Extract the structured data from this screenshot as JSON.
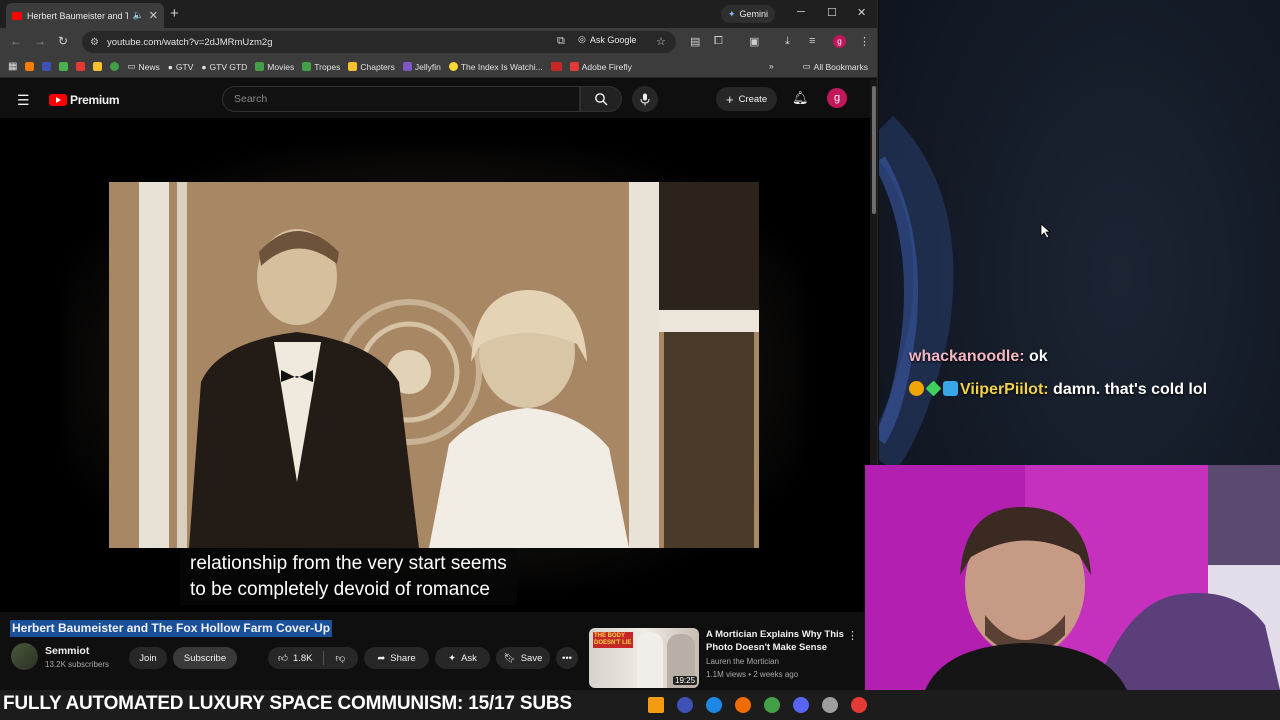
{
  "browser": {
    "tab_title": "Herbert Baumeister and The...",
    "gemini_label": "Gemini",
    "url": "youtube.com/watch?v=2dJMRmUzm2g",
    "ask_google": "Ask Google",
    "profile_initial": "g",
    "bookmarks": [
      "News",
      "GTV",
      "GTV GTD",
      "Movies",
      "Tropes",
      "Chapters",
      "Jellyfin",
      "The Index Is Watchi...",
      "Adobe Firefly"
    ],
    "all_bookmarks": "All Bookmarks"
  },
  "youtube": {
    "logo_text": "Premium",
    "search_placeholder": "Search",
    "create_label": "Create",
    "avatar_initial": "g"
  },
  "video": {
    "caption_line1": "relationship from the very start seems",
    "caption_line2": "to be completely devoid of romance",
    "title": "Herbert Baumeister and The Fox Hollow Farm Cover-Up",
    "channel": "Semmiot",
    "subscribers": "13.2K subscribers",
    "join": "Join",
    "subscribe": "Subscribe",
    "likes": "1.8K",
    "share": "Share",
    "ask": "Ask",
    "save": "Save"
  },
  "recommendation": {
    "title": "A Mortician Explains Why This Photo Doesn't Make Sense",
    "channel": "Lauren the Mortician",
    "stats": "1.1M views • 2 weeks ago",
    "duration": "19:25",
    "thumb_text": "THE BODY DOESN'T LIE"
  },
  "chat": [
    {
      "user": "whackanoodle:",
      "message": " ok"
    },
    {
      "user": "ViiperPiilot:",
      "message": " damn. that's cold lol"
    }
  ],
  "banner": {
    "text": "FULLY AUTOMATED LUXURY SPACE COMMUNISM: 15/17 SUBS"
  }
}
